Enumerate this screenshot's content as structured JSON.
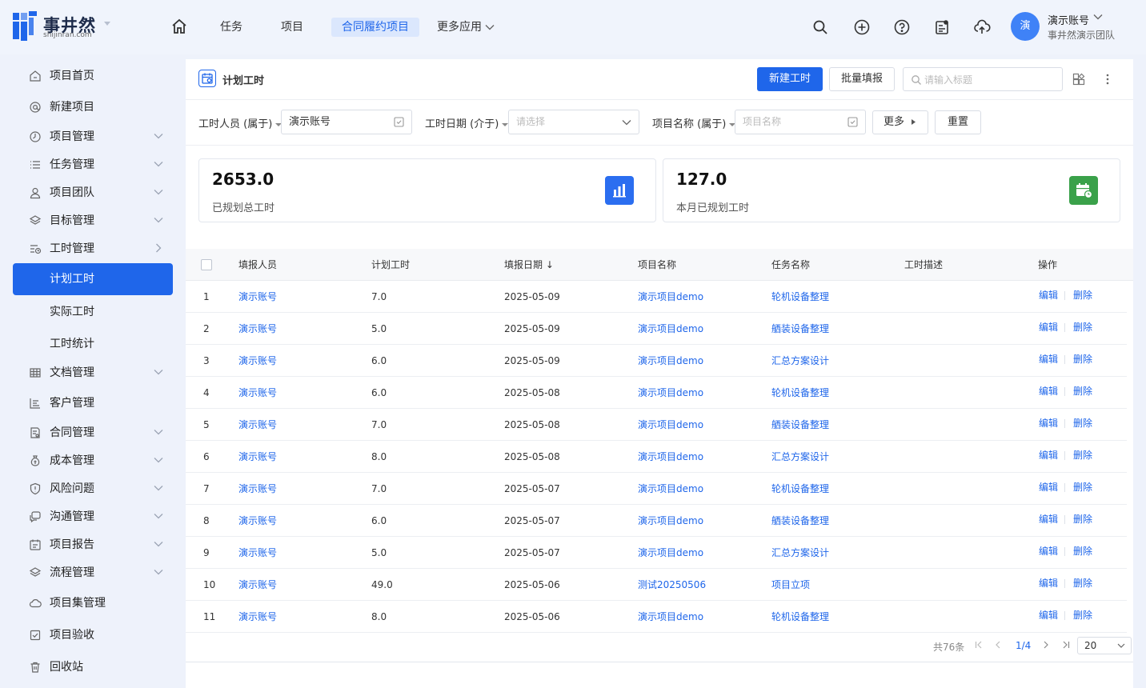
{
  "brand": {
    "name": "事井然",
    "domain": "shijinran.com"
  },
  "topnav": {
    "items": [
      "任务",
      "项目",
      "合同履约项目",
      "更多应用"
    ],
    "active": "合同履约项目"
  },
  "user": {
    "avatar_text": "演",
    "name": "演示账号",
    "team": "事井然演示团队"
  },
  "sidebar": {
    "items": [
      {
        "label": "项目首页",
        "icon": "home-icon",
        "expandable": false
      },
      {
        "label": "新建项目",
        "icon": "at-icon",
        "expandable": false
      },
      {
        "label": "项目管理",
        "icon": "clock-icon",
        "expandable": true
      },
      {
        "label": "任务管理",
        "icon": "list-icon",
        "expandable": true
      },
      {
        "label": "项目团队",
        "icon": "user-icon",
        "expandable": true
      },
      {
        "label": "目标管理",
        "icon": "layers-icon",
        "expandable": true
      },
      {
        "label": "工时管理",
        "icon": "timesheet-icon",
        "expandable": true,
        "expanded": true
      },
      {
        "label": "计划工时",
        "sub": true,
        "active": true
      },
      {
        "label": "实际工时",
        "sub": true
      },
      {
        "label": "工时统计",
        "sub": true
      },
      {
        "label": "文档管理",
        "icon": "table-icon",
        "expandable": true
      },
      {
        "label": "客户管理",
        "icon": "chart-icon",
        "expandable": false
      },
      {
        "label": "合同管理",
        "icon": "contract-icon",
        "expandable": true
      },
      {
        "label": "成本管理",
        "icon": "moneybag-icon",
        "expandable": true
      },
      {
        "label": "风险问题",
        "icon": "shield-icon",
        "expandable": true
      },
      {
        "label": "沟通管理",
        "icon": "chat-icon",
        "expandable": true
      },
      {
        "label": "项目报告",
        "icon": "report-icon",
        "expandable": true
      },
      {
        "label": "流程管理",
        "icon": "flow-icon",
        "expandable": true
      },
      {
        "label": "项目集管理",
        "icon": "cloud-icon",
        "expandable": false
      },
      {
        "label": "项目验收",
        "icon": "check-icon",
        "expandable": false
      },
      {
        "label": "回收站",
        "icon": "trash-icon",
        "expandable": false
      }
    ]
  },
  "page": {
    "title": "计划工时",
    "new_button": "新建工时",
    "batch_button": "批量填报",
    "search_placeholder": "请输入标题"
  },
  "filters": {
    "person_label": "工时人员 (属于)",
    "person_value": "演示账号",
    "date_label": "工时日期 (介于)",
    "date_placeholder": "请选择",
    "project_label": "项目名称 (属于)",
    "project_placeholder": "项目名称",
    "more_button": "更多",
    "reset_button": "重置"
  },
  "stats": [
    {
      "value": "2653.0",
      "label": "已规划总工时",
      "icon": "bar-chart-icon",
      "color": "#2b6ef0"
    },
    {
      "value": "127.0",
      "label": "本月已规划工时",
      "icon": "calendar-clock-icon",
      "color": "#3aa14a"
    }
  ],
  "table": {
    "columns": [
      "填报人员",
      "计划工时",
      "填报日期",
      "项目名称",
      "任务名称",
      "工时描述",
      "操作"
    ],
    "sort_indicator": "↓",
    "action_edit": "编辑",
    "action_delete": "删除",
    "rows": [
      {
        "idx": "1",
        "person": "演示账号",
        "hours": "7.0",
        "date": "2025-05-09",
        "project": "演示项目demo",
        "task": "轮机设备整理",
        "desc": ""
      },
      {
        "idx": "2",
        "person": "演示账号",
        "hours": "5.0",
        "date": "2025-05-09",
        "project": "演示项目demo",
        "task": "舾装设备整理",
        "desc": ""
      },
      {
        "idx": "3",
        "person": "演示账号",
        "hours": "6.0",
        "date": "2025-05-09",
        "project": "演示项目demo",
        "task": "汇总方案设计",
        "desc": ""
      },
      {
        "idx": "4",
        "person": "演示账号",
        "hours": "6.0",
        "date": "2025-05-08",
        "project": "演示项目demo",
        "task": "轮机设备整理",
        "desc": ""
      },
      {
        "idx": "5",
        "person": "演示账号",
        "hours": "7.0",
        "date": "2025-05-08",
        "project": "演示项目demo",
        "task": "舾装设备整理",
        "desc": ""
      },
      {
        "idx": "6",
        "person": "演示账号",
        "hours": "8.0",
        "date": "2025-05-08",
        "project": "演示项目demo",
        "task": "汇总方案设计",
        "desc": ""
      },
      {
        "idx": "7",
        "person": "演示账号",
        "hours": "7.0",
        "date": "2025-05-07",
        "project": "演示项目demo",
        "task": "轮机设备整理",
        "desc": ""
      },
      {
        "idx": "8",
        "person": "演示账号",
        "hours": "6.0",
        "date": "2025-05-07",
        "project": "演示项目demo",
        "task": "舾装设备整理",
        "desc": ""
      },
      {
        "idx": "9",
        "person": "演示账号",
        "hours": "5.0",
        "date": "2025-05-07",
        "project": "演示项目demo",
        "task": "汇总方案设计",
        "desc": ""
      },
      {
        "idx": "10",
        "person": "演示账号",
        "hours": "49.0",
        "date": "2025-05-06",
        "project": "测试20250506",
        "task": "项目立项",
        "desc": ""
      },
      {
        "idx": "11",
        "person": "演示账号",
        "hours": "8.0",
        "date": "2025-05-06",
        "project": "演示项目demo",
        "task": "轮机设备整理",
        "desc": ""
      }
    ]
  },
  "pagination": {
    "total": "共76条",
    "page": "1/4",
    "page_size": "20"
  },
  "colors": {
    "accent": "#1f66ea",
    "sidebar_bg": "#eef2fb"
  }
}
